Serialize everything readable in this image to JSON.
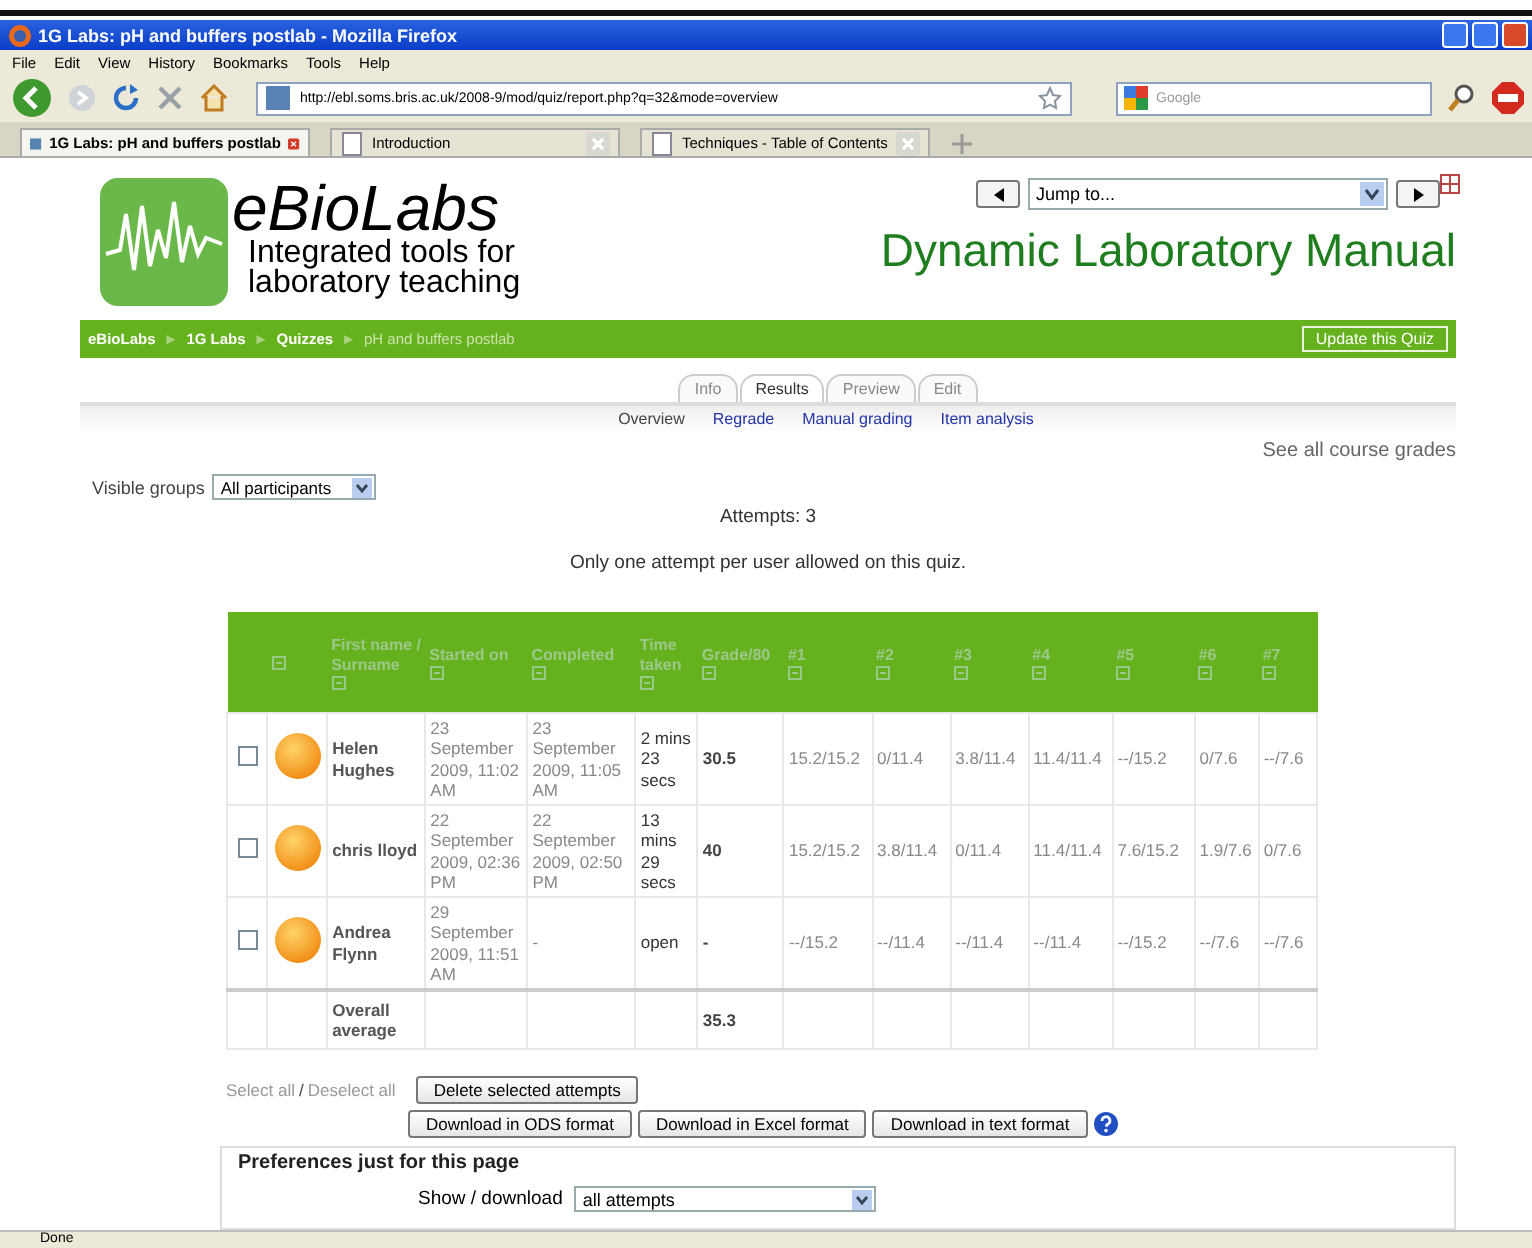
{
  "browser": {
    "title": "1G Labs: pH and buffers postlab - Mozilla Firefox",
    "menu": [
      "File",
      "Edit",
      "View",
      "History",
      "Bookmarks",
      "Tools",
      "Help"
    ],
    "url": "http://ebl.soms.bris.ac.uk/2008-9/mod/quiz/report.php?q=32&mode=overview",
    "search_placeholder": "Google",
    "tabs": [
      {
        "label": "1G Labs: pH and buffers postlab",
        "selected": true
      },
      {
        "label": "Introduction",
        "selected": false
      },
      {
        "label": "Techniques - Table of Contents",
        "selected": false
      }
    ],
    "status": "Done"
  },
  "page": {
    "logo": {
      "name": "eBioLabs",
      "tagline": "Integrated tools for laboratory teaching"
    },
    "jump_placeholder": "Jump to...",
    "heading": "Dynamic Laboratory Manual",
    "breadcrumb": {
      "separator": "►",
      "items": [
        {
          "label": "eBioLabs",
          "current": false
        },
        {
          "label": "1G Labs",
          "current": false
        },
        {
          "label": "Quizzes",
          "current": false
        },
        {
          "label": "pH and buffers postlab",
          "current": true
        }
      ]
    },
    "update_button": "Update this Quiz",
    "tabs": [
      {
        "label": "Info",
        "selected": false
      },
      {
        "label": "Results",
        "selected": true
      },
      {
        "label": "Preview",
        "selected": false
      },
      {
        "label": "Edit",
        "selected": false
      }
    ],
    "subtabs": [
      {
        "label": "Overview",
        "selected": true
      },
      {
        "label": "Regrade",
        "selected": false
      },
      {
        "label": "Manual grading",
        "selected": false
      },
      {
        "label": "Item analysis",
        "selected": false
      }
    ],
    "grades_link": "See all course grades",
    "visible_groups": {
      "label": "Visible groups",
      "value": "All participants"
    },
    "attempts": "Attempts: 3",
    "notice": "Only one attempt per user allowed on this quiz.",
    "table": {
      "columns": [
        {
          "label": "First name / Surname"
        },
        {
          "label": "Started on"
        },
        {
          "label": "Completed"
        },
        {
          "label": "Time taken"
        },
        {
          "label": "Grade/80"
        },
        {
          "label": "#1"
        },
        {
          "label": "#2"
        },
        {
          "label": "#3"
        },
        {
          "label": "#4"
        },
        {
          "label": "#5"
        },
        {
          "label": "#6"
        },
        {
          "label": "#7"
        }
      ],
      "rows": [
        {
          "checked": false,
          "name": "Helen Hughes",
          "started": "23 September 2009, 11:02 AM",
          "completed": "23 September 2009, 11:05 AM",
          "time_taken": "2 mins 23 secs",
          "grade": "30.5",
          "marks": [
            "15.2/15.2",
            "0/11.4",
            "3.8/11.4",
            "11.4/11.4",
            "--/15.2",
            "0/7.6",
            "--/7.6"
          ]
        },
        {
          "checked": false,
          "name": "chris lloyd",
          "started": "22 September 2009, 02:36 PM",
          "completed": "22 September 2009, 02:50 PM",
          "time_taken": "13 mins 29 secs",
          "grade": "40",
          "marks": [
            "15.2/15.2",
            "3.8/11.4",
            "0/11.4",
            "11.4/11.4",
            "7.6/15.2",
            "1.9/7.6",
            "0/7.6"
          ]
        },
        {
          "checked": false,
          "name": "Andrea Flynn",
          "started": "29 September 2009, 11:51 AM",
          "completed": "-",
          "time_taken": "open",
          "grade": "-",
          "marks": [
            "--/15.2",
            "--/11.4",
            "--/11.4",
            "--/11.4",
            "--/15.2",
            "--/7.6",
            "--/7.6"
          ]
        }
      ],
      "average": {
        "label": "Overall average",
        "grade": "35.3"
      }
    },
    "select_all": "Select all",
    "select_separator": "/",
    "deselect_all": "Deselect all",
    "delete_button": "Delete selected attempts",
    "downloads": [
      "Download in ODS format",
      "Download in Excel format",
      "Download in text format"
    ],
    "preferences": {
      "legend": "Preferences just for this page",
      "show_label": "Show / download",
      "show_value": "all attempts"
    }
  }
}
